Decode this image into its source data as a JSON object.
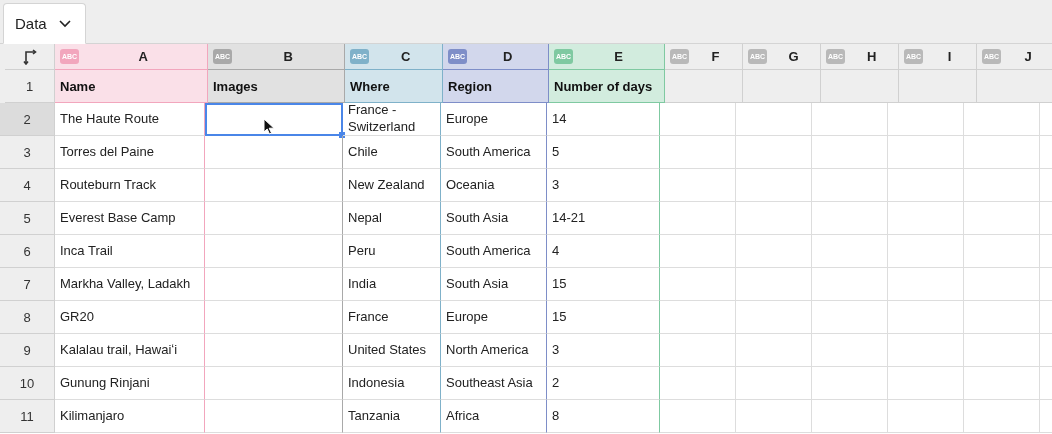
{
  "tab": {
    "label": "Data",
    "selected": true
  },
  "header_row_number": "1",
  "columns": [
    {
      "letter": "A",
      "type": "ABC",
      "color": "#f2a6bd",
      "header": "Name"
    },
    {
      "letter": "B",
      "type": "ABC",
      "color": "#a9a9a9",
      "header": "Images"
    },
    {
      "letter": "C",
      "type": "ABC",
      "color": "#7fb1c9",
      "header": "Where"
    },
    {
      "letter": "D",
      "type": "ABC",
      "color": "#7e8ec8",
      "header": "Region"
    },
    {
      "letter": "E",
      "type": "ABC",
      "color": "#7fc9a1",
      "header": "Number of days"
    },
    {
      "letter": "F",
      "type": "ABC",
      "color": "#b9b9b9"
    },
    {
      "letter": "G",
      "type": "ABC",
      "color": "#b9b9b9"
    },
    {
      "letter": "H",
      "type": "ABC",
      "color": "#b9b9b9"
    },
    {
      "letter": "I",
      "type": "ABC",
      "color": "#b9b9b9"
    },
    {
      "letter": "J",
      "type": "ABC",
      "color": "#b9b9b9"
    }
  ],
  "rows": [
    {
      "number": "2",
      "selected": true,
      "cells": [
        {
          "text": "The Haute Route",
          "selected": false
        },
        {
          "selected": true
        },
        {
          "text": "France - Switzerland",
          "selected": false
        },
        {
          "text": "Europe",
          "selected": false
        },
        {
          "text": "14",
          "selected": false
        }
      ]
    },
    {
      "number": "3",
      "selected": false,
      "cells": [
        {
          "text": "Torres del Paine",
          "selected": false
        },
        {
          "selected": false
        },
        {
          "text": "Chile",
          "selected": false
        },
        {
          "text": "South America",
          "selected": false
        },
        {
          "text": "5",
          "selected": false
        }
      ]
    },
    {
      "number": "4",
      "selected": false,
      "cells": [
        {
          "text": "Routeburn Track",
          "selected": false
        },
        {
          "selected": false
        },
        {
          "text": "New Zealand",
          "selected": false
        },
        {
          "text": "Oceania",
          "selected": false
        },
        {
          "text": "3",
          "selected": false
        }
      ]
    },
    {
      "number": "5",
      "selected": false,
      "cells": [
        {
          "text": "Everest Base Camp",
          "selected": false
        },
        {
          "selected": false
        },
        {
          "text": "Nepal",
          "selected": false
        },
        {
          "text": "South Asia",
          "selected": false
        },
        {
          "text": "14-21",
          "selected": false
        }
      ]
    },
    {
      "number": "6",
      "selected": false,
      "cells": [
        {
          "text": "Inca Trail",
          "selected": false
        },
        {
          "selected": false
        },
        {
          "text": "Peru",
          "selected": false
        },
        {
          "text": "South America",
          "selected": false
        },
        {
          "text": "4",
          "selected": false
        }
      ]
    },
    {
      "number": "7",
      "selected": false,
      "cells": [
        {
          "text": "Markha Valley, Ladakh",
          "selected": false
        },
        {
          "selected": false
        },
        {
          "text": "India",
          "selected": false
        },
        {
          "text": "South Asia",
          "selected": false
        },
        {
          "text": "15",
          "selected": false
        }
      ]
    },
    {
      "number": "8",
      "selected": false,
      "cells": [
        {
          "text": "GR20",
          "selected": false
        },
        {
          "selected": false
        },
        {
          "text": "France",
          "selected": false
        },
        {
          "text": "Europe",
          "selected": false
        },
        {
          "text": "15",
          "selected": false
        }
      ]
    },
    {
      "number": "9",
      "selected": false,
      "cells": [
        {
          "text": "Kalalau trail, Hawaiʻi",
          "selected": false
        },
        {
          "selected": false
        },
        {
          "text": "United States",
          "selected": false
        },
        {
          "text": "North America",
          "selected": false
        },
        {
          "text": "3",
          "selected": false
        }
      ]
    },
    {
      "number": "10",
      "selected": false,
      "cells": [
        {
          "text": "Gunung Rinjani",
          "selected": false
        },
        {
          "selected": false
        },
        {
          "text": "Indonesia",
          "selected": false
        },
        {
          "text": "Southeast Asia",
          "selected": false
        },
        {
          "text": "2",
          "selected": false
        }
      ]
    },
    {
      "number": "11",
      "selected": false,
      "cells": [
        {
          "text": "Kilimanjaro",
          "selected": false
        },
        {
          "selected": false
        },
        {
          "text": "Tanzania",
          "selected": false
        },
        {
          "text": "Africa",
          "selected": false
        },
        {
          "text": "8",
          "selected": false
        }
      ]
    }
  ]
}
